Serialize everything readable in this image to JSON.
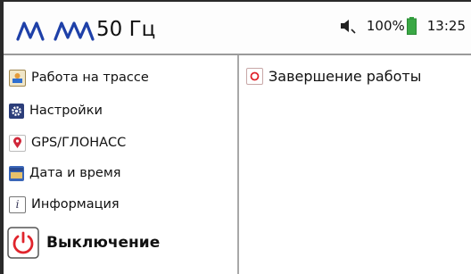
{
  "header": {
    "frequency": "50 Гц",
    "battery_percent": "100%",
    "time": "13:25",
    "icons": [
      "signal-wave-icon",
      "speaker-muted-icon",
      "battery-icon"
    ],
    "signal_color": "#1e40a8",
    "battery_color": "#3aa845"
  },
  "sidebar": {
    "items": [
      {
        "label": "Работа на трассе",
        "icon": "route-work-icon"
      },
      {
        "label": "Настройки",
        "icon": "gear-icon"
      },
      {
        "label": "GPS/ГЛОНАСС",
        "icon": "location-pin-icon"
      },
      {
        "label": "Дата и время",
        "icon": "calendar-icon"
      },
      {
        "label": "Информация",
        "icon": "info-icon"
      }
    ],
    "power_label": "Выключение",
    "power_icon": "power-icon",
    "power_color": "#e0242c"
  },
  "content": {
    "items": [
      {
        "label": "Завершение работы",
        "icon": "stop-icon"
      }
    ]
  }
}
